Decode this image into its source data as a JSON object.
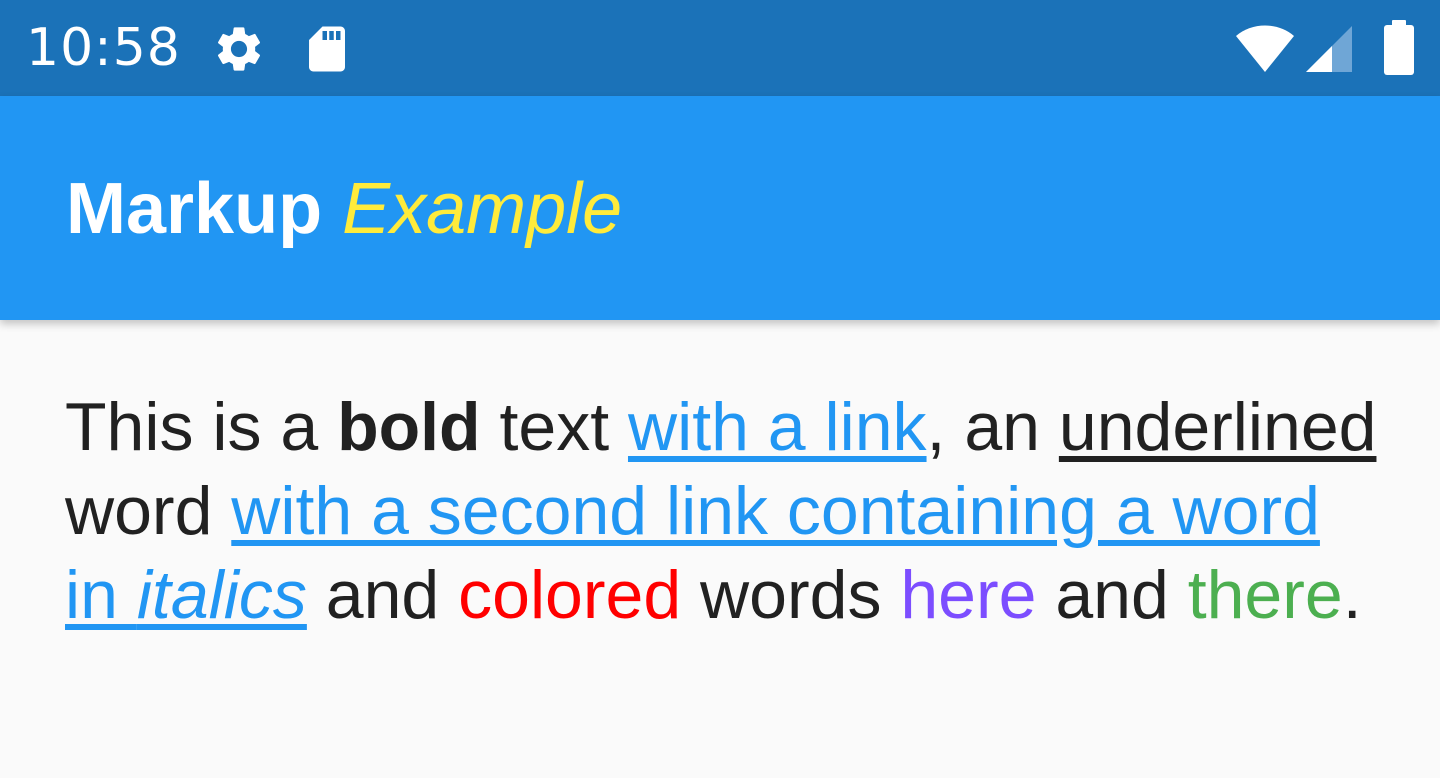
{
  "status_bar": {
    "time": "10:58",
    "icons": [
      "gear-icon",
      "sd-card-icon",
      "wifi-icon",
      "cell-signal-icon",
      "battery-icon"
    ]
  },
  "app_bar": {
    "title_bold": "Markup",
    "title_italic": "Example"
  },
  "content": {
    "seg1": "This is a ",
    "bold": "bold",
    "seg2": " text ",
    "link1": "with a link",
    "seg3": ", an ",
    "underlined": "underlined",
    "seg4": " word ",
    "link2_part1": "with a second link containing a word in ",
    "link2_italic": "italics",
    "seg5": " and ",
    "colored": "colored",
    "seg6": " words ",
    "here": "here",
    "seg7": " and ",
    "there": "there",
    "seg8": "."
  },
  "colors": {
    "status_bar": "#1b72b8",
    "app_bar": "#2196f3",
    "title_italic": "#ffeb3b",
    "link": "#2196f3",
    "colored": "#ff0000",
    "here": "#7c4dff",
    "there": "#4caf50",
    "text": "#212121",
    "background": "#fafafa"
  }
}
